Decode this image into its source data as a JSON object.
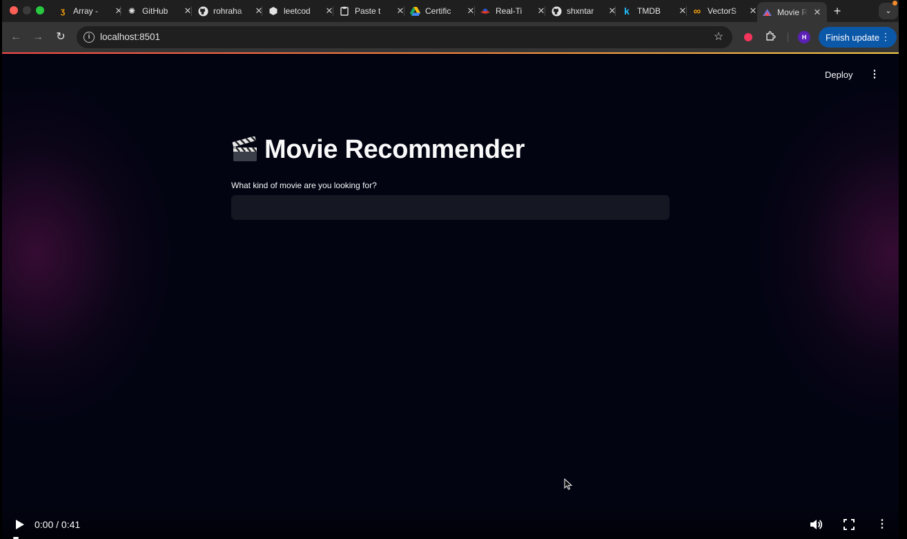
{
  "browser": {
    "tabs": [
      {
        "label": "Array -",
        "icon": "orange-code-icon"
      },
      {
        "label": "GitHub",
        "icon": "openai-icon"
      },
      {
        "label": "rohraha",
        "icon": "github-icon"
      },
      {
        "label": "leetcod",
        "icon": "cube-icon"
      },
      {
        "label": "Paste t",
        "icon": "clipboard-icon"
      },
      {
        "label": "Certific",
        "icon": "google-drive-icon"
      },
      {
        "label": "Real-Ti",
        "icon": "redis-icon"
      },
      {
        "label": "shxntar",
        "icon": "github-icon"
      },
      {
        "label": "TMDB",
        "icon": "kaggle-icon"
      },
      {
        "label": "VectorS",
        "icon": "infinity-icon"
      }
    ],
    "active_tab": {
      "label": "Movie R",
      "icon": "streamlit-icon"
    },
    "url": "localhost:8501",
    "finish_update_label": "Finish update",
    "profile_initial": "H"
  },
  "app": {
    "deploy_label": "Deploy",
    "title": "Movie Recommender",
    "input_label": "What kind of movie are you looking for?",
    "input_value": ""
  },
  "video": {
    "time": "0:00 / 0:41",
    "progress": 0
  },
  "colors": {
    "finish_update_bg": "#0b57a8",
    "app_bg": "#020412",
    "input_bg": "#151722"
  }
}
